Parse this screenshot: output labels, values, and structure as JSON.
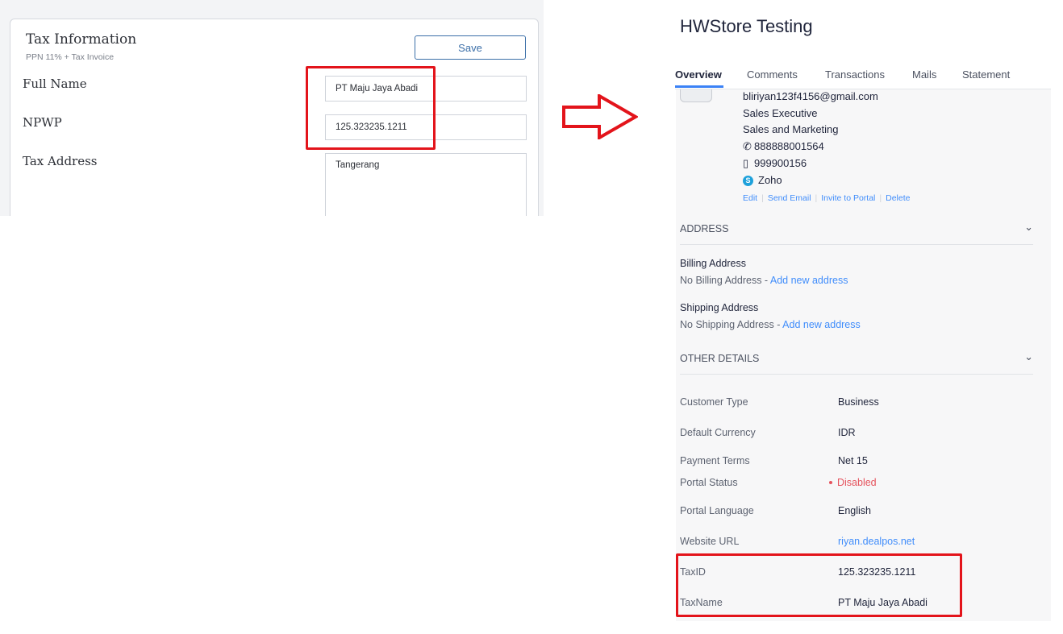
{
  "tax_form": {
    "title": "Tax Information",
    "subtitle": "PPN 11% + Tax Invoice",
    "save_label": "Save",
    "full_name_label": "Full Name",
    "full_name_value": "PT Maju Jaya Abadi",
    "npwp_label": "NPWP",
    "npwp_value": "125.323235.1211",
    "tax_address_label": "Tax Address",
    "tax_address_value": "Tangerang"
  },
  "arrow": {
    "icon": "right-arrow-outline-icon",
    "color": "#e3141b"
  },
  "contact": {
    "title": "HWStore Testing",
    "tabs": [
      {
        "label": "Overview",
        "active": true
      },
      {
        "label": "Comments"
      },
      {
        "label": "Transactions"
      },
      {
        "label": "Mails"
      },
      {
        "label": "Statement"
      }
    ],
    "person": {
      "email": "bliriyan123f4156@gmail.com",
      "designation": "Sales Executive",
      "department": "Sales and Marketing",
      "phone": "888888001564",
      "mobile": "999900156",
      "skype": "Zoho"
    },
    "actions": [
      "Edit",
      "Send Email",
      "Invite to Portal",
      "Delete"
    ],
    "address_section": {
      "heading": "ADDRESS",
      "billing_label": "Billing Address",
      "billing_value": "No Billing Address - ",
      "billing_link": "Add new address",
      "shipping_label": "Shipping Address",
      "shipping_value": "No Shipping Address - ",
      "shipping_link": "Add new address"
    },
    "other_details": {
      "heading": "OTHER DETAILS",
      "rows": [
        {
          "key": "Customer Type",
          "value": "Business"
        },
        {
          "key": "Default Currency",
          "value": "IDR"
        },
        {
          "key": "Payment Terms",
          "value": "Net 15"
        },
        {
          "key": "Portal Status",
          "value": "Disabled"
        },
        {
          "key": "Portal Language",
          "value": "English"
        },
        {
          "key": "Website URL",
          "value": "riyan.dealpos.net"
        },
        {
          "key": "TaxID",
          "value": "125.323235.1211"
        },
        {
          "key": "TaxName",
          "value": "PT Maju Jaya Abadi"
        }
      ]
    }
  },
  "colors": {
    "highlight": "#e3141b",
    "link": "#408dfb",
    "accent_tab": "#3b82f6",
    "disabled_status": "#e5535d",
    "save_button": "#3b6fa8"
  }
}
